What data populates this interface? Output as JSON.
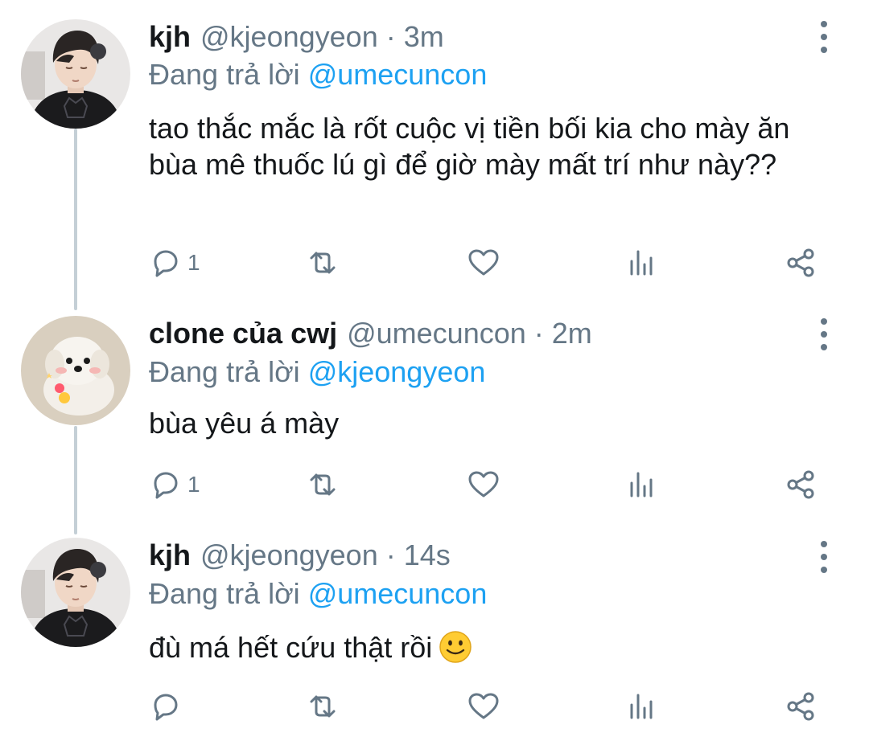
{
  "tweets": [
    {
      "display_name": "kjh",
      "handle": "@kjeongyeon",
      "separator": "·",
      "time": "3m",
      "reply_prefix": "Đang trả lời",
      "reply_handle": "@umecuncon",
      "text": "tao thắc mắc là rốt cuộc vị tiền bối kia cho mày ăn bùa mê thuốc lú gì để giờ mày mất trí như này??",
      "reply_count": "1",
      "avatar": "boy-black-shirt"
    },
    {
      "display_name": "clone của cwj",
      "handle": "@umecuncon",
      "separator": "·",
      "time": "2m",
      "reply_prefix": "Đang trả lời",
      "reply_handle": "@kjeongyeon",
      "text": "bùa yêu á mày",
      "reply_count": "1",
      "avatar": "white-puppy"
    },
    {
      "display_name": "kjh",
      "handle": "@kjeongyeon",
      "separator": "·",
      "time": "14s",
      "reply_prefix": "Đang trả lời",
      "reply_handle": "@umecuncon",
      "text": "đù má hết cứu thật rồi",
      "reply_count": "",
      "emoji": "slightly-smiling-face",
      "avatar": "boy-black-shirt"
    }
  ],
  "icons": {
    "reply": "reply-icon",
    "retweet": "retweet-icon",
    "like": "heart-icon",
    "analytics": "analytics-icon",
    "share": "share-icon",
    "more": "more-vertical-icon"
  },
  "colors": {
    "link": "#1da1f2",
    "secondary_text": "#657786",
    "thread_line": "#c4cfd6",
    "primary_text": "#14171a"
  }
}
